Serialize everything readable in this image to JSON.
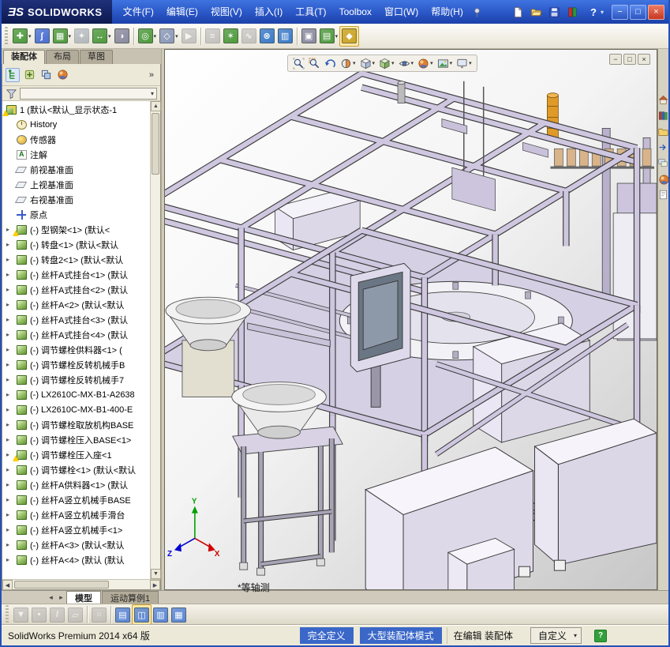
{
  "glyphs": {
    "dropdown": "▾"
  },
  "scrollbar": {
    "up": "▲",
    "down": "▼",
    "left": "◀",
    "right": "▶"
  },
  "colors": {
    "highlight_blue": "#3a67c8",
    "warning_yellow": "#ffcc00",
    "model_lavender": "#cfc7e0",
    "title_blue": "#2a56c6"
  },
  "titlebar": {
    "logo_prefix": "ƎS",
    "logo_name": "SOLIDWORKS",
    "menus": [
      "文件(F)",
      "编辑(E)",
      "视图(V)",
      "插入(I)",
      "工具(T)",
      "Toolbox",
      "窗口(W)",
      "帮助(H)"
    ],
    "quick_tools": [
      {
        "name": "new-document-icon",
        "icon": "new"
      },
      {
        "name": "open-document-icon",
        "icon": "open"
      },
      {
        "name": "save-document-icon",
        "icon": "save"
      },
      {
        "name": "options-icon",
        "icon": "options"
      }
    ],
    "help_label": "?",
    "controls": [
      {
        "name": "minimize-button",
        "glyph": "−"
      },
      {
        "name": "maximize-button",
        "glyph": "□"
      },
      {
        "name": "close-button",
        "glyph": "×"
      }
    ]
  },
  "main_toolbar": {
    "buttons": [
      {
        "name": "insert-components-button",
        "glyph": "✚",
        "color": "#4e9a3e",
        "dropdown": true
      },
      {
        "name": "mate-button",
        "glyph": "ʃ",
        "color": "#4a6fd4"
      },
      {
        "name": "linear-component-pattern-button",
        "glyph": "▦",
        "color": "#4e9a3e",
        "dropdown": true
      },
      {
        "name": "smart-fasteners-button",
        "glyph": "✦",
        "color": "#3a7ac8",
        "disabled": true
      },
      {
        "name": "move-component-button",
        "glyph": "↔",
        "color": "#4e9a3e",
        "dropdown": true
      },
      {
        "name": "show-hidden-components-button",
        "glyph": "◑",
        "color": "#8a8aa0"
      },
      {
        "sep": true
      },
      {
        "name": "assembly-features-button",
        "glyph": "◎",
        "color": "#4e9a3e",
        "dropdown": true
      },
      {
        "name": "reference-geometry-button",
        "glyph": "◇",
        "color": "#8a98b8",
        "dropdown": true
      },
      {
        "name": "new-motion-study-button",
        "glyph": "▶",
        "color": "#8a8aa0",
        "disabled": true
      },
      {
        "sep": true
      },
      {
        "name": "bill-of-materials-button",
        "glyph": "≡",
        "color": "#8a8aa0",
        "disabled": true
      },
      {
        "name": "exploded-view-button",
        "glyph": "✶",
        "color": "#4e9a3e"
      },
      {
        "name": "explode-line-sketch-button",
        "glyph": "∿",
        "color": "#8a8aa0",
        "disabled": true
      },
      {
        "name": "interference-detection-button",
        "glyph": "⊗",
        "color": "#3a7ac8"
      },
      {
        "name": "assembly-visualization-button",
        "glyph": "▥",
        "color": "#3a7ac8"
      },
      {
        "sep": true
      },
      {
        "name": "isolate-button",
        "glyph": "▣",
        "color": "#8a8aa0"
      },
      {
        "name": "large-assembly-mode-button",
        "glyph": "▤",
        "color": "#4e9a3e",
        "dropdown": true
      },
      {
        "name": "instant3d-button",
        "glyph": "◆",
        "color": "#caa428",
        "pressed": true
      }
    ]
  },
  "headsup": {
    "icons": [
      {
        "name": "zoom-to-fit-icon",
        "icon": "zoomfit"
      },
      {
        "name": "zoom-to-area-icon",
        "icon": "zoomarea"
      },
      {
        "name": "previous-view-icon",
        "icon": "prevview"
      },
      {
        "name": "section-view-icon",
        "icon": "section",
        "dropdown": true
      },
      {
        "name": "view-orientation-icon",
        "icon": "cube",
        "dropdown": true
      },
      {
        "name": "display-style-icon",
        "icon": "cube2",
        "dropdown": true
      },
      {
        "name": "hide-show-items-icon",
        "icon": "eye",
        "dropdown": true
      },
      {
        "name": "edit-appearance-icon",
        "icon": "ball",
        "dropdown": true
      },
      {
        "name": "apply-scene-icon",
        "icon": "scene",
        "dropdown": true
      },
      {
        "name": "view-settings-icon",
        "icon": "monitor",
        "dropdown": true
      }
    ],
    "child_controls": [
      {
        "name": "document-minimize-button",
        "glyph": "−"
      },
      {
        "name": "document-restore-button",
        "glyph": "□"
      },
      {
        "name": "document-close-button",
        "glyph": "×"
      }
    ]
  },
  "left_panel": {
    "tabs": [
      {
        "label": "装配体",
        "active": true
      },
      {
        "label": "布局",
        "active": false
      },
      {
        "label": "草图",
        "active": false
      }
    ],
    "manager_tabs": [
      {
        "name": "featuremanager-tab-icon",
        "icon": "fmtree",
        "selected": true
      },
      {
        "name": "propertymanager-tab-icon",
        "icon": "pmgr"
      },
      {
        "name": "configurationmanager-tab-icon",
        "icon": "cfgmgr"
      },
      {
        "name": "displaymanager-tab-icon",
        "icon": "ball"
      }
    ],
    "overflow_label": "»",
    "tree": [
      {
        "label": "1 (默认<默认_显示状态-1",
        "icon": "assembly",
        "warning": true,
        "expandable": false
      },
      {
        "label": "History",
        "icon": "history",
        "expandable": false
      },
      {
        "label": "传感器",
        "icon": "sensors",
        "expandable": false
      },
      {
        "label": "注解",
        "icon": "annotations",
        "expandable": false
      },
      {
        "label": "前视基准面",
        "icon": "plane",
        "expandable": false
      },
      {
        "label": "上视基准面",
        "icon": "plane",
        "expandable": false
      },
      {
        "label": "右视基准面",
        "icon": "plane",
        "expandable": false
      },
      {
        "label": "原点",
        "icon": "origin",
        "expandable": false
      },
      {
        "label": "(-) 型钢架<1> (默认<",
        "icon": "part",
        "warning": true,
        "expandable": true
      },
      {
        "label": "(-) 转盘<1> (默认<默认",
        "icon": "part",
        "expandable": true
      },
      {
        "label": "(-) 转盘2<1> (默认<默认",
        "icon": "part",
        "expandable": true
      },
      {
        "label": "(-) 丝杆A式挂台<1> (默认",
        "icon": "part",
        "expandable": true
      },
      {
        "label": "(-) 丝杆A式挂台<2> (默认",
        "icon": "part",
        "expandable": true
      },
      {
        "label": "(-) 丝杆A<2> (默认<默认",
        "icon": "part",
        "expandable": true
      },
      {
        "label": "(-) 丝杆A式挂台<3> (默认",
        "icon": "part",
        "expandable": true
      },
      {
        "label": "(-) 丝杆A式挂台<4> (默认",
        "icon": "part",
        "expandable": true
      },
      {
        "label": "(-) 调节螺栓供料器<1> (",
        "icon": "part",
        "expandable": true
      },
      {
        "label": "(-) 调节螺栓反转机械手B",
        "icon": "part",
        "expandable": true
      },
      {
        "label": "(-) 调节螺栓反转机械手7",
        "icon": "part",
        "expandable": true
      },
      {
        "label": "(-) LX2610C-MX-B1-A2638",
        "icon": "part",
        "expandable": true
      },
      {
        "label": "(-) LX2610C-MX-B1-400-E",
        "icon": "part",
        "expandable": true
      },
      {
        "label": "(-) 调节螺栓取放机构BASE",
        "icon": "part",
        "expandable": true
      },
      {
        "label": "(-) 调节螺栓压入BASE<1>",
        "icon": "part",
        "expandable": true
      },
      {
        "label": "(-) 调节螺栓压入座<1",
        "icon": "part",
        "warning": true,
        "expandable": true
      },
      {
        "label": "(-) 调节螺栓<1> (默认<默认",
        "icon": "part",
        "expandable": true
      },
      {
        "label": "(-) 丝杆A供料器<1> (默认",
        "icon": "part",
        "expandable": true
      },
      {
        "label": "(-) 丝杆A竖立机械手BASE",
        "icon": "part",
        "expandable": true
      },
      {
        "label": "(-) 丝杆A竖立机械手滑台",
        "icon": "part",
        "expandable": true
      },
      {
        "label": "(-) 丝杆A竖立机械手<1>",
        "icon": "part",
        "expandable": true
      },
      {
        "label": "(-) 丝杆A<3> (默认<默认",
        "icon": "part",
        "expandable": true
      },
      {
        "label": "(-) 丝杆A<4> (默认 (默认",
        "icon": "part",
        "expandable": true
      }
    ]
  },
  "task_pane": {
    "icons": [
      {
        "name": "solidworks-resources-icon",
        "icon": "home"
      },
      {
        "name": "design-library-icon",
        "icon": "library"
      },
      {
        "name": "file-explorer-icon",
        "icon": "folder"
      },
      {
        "name": "dock-expand-icon",
        "icon": "arrows"
      },
      {
        "name": "view-palette-icon",
        "icon": "palette"
      },
      {
        "name": "appearances-scenes-icon",
        "icon": "ball"
      },
      {
        "name": "custom-properties-icon",
        "icon": "page"
      }
    ]
  },
  "viewport": {
    "orientation_label": "*等轴测",
    "triad": {
      "x": "X",
      "y": "Y",
      "z": "Z"
    }
  },
  "bottom_tabs": {
    "nav": [
      {
        "name": "tab-scroll-left-button",
        "glyph": "◂"
      },
      {
        "name": "tab-scroll-right-button",
        "glyph": "▸"
      }
    ],
    "items": [
      {
        "label": "模型",
        "active": true
      },
      {
        "label": "运动算例1",
        "active": false
      }
    ]
  },
  "selection_toolbar": {
    "buttons": [
      {
        "name": "toggle-selection-filters-button",
        "glyph": "▼",
        "color": "#9a96a8",
        "disabled": true
      },
      {
        "name": "filter-vertices-button",
        "glyph": "•",
        "color": "#9a96a8",
        "disabled": true
      },
      {
        "name": "filter-edges-button",
        "glyph": "/",
        "color": "#9a96a8",
        "disabled": true
      },
      {
        "name": "filter-faces-button",
        "glyph": "▱",
        "color": "#9a96a8",
        "disabled": true
      },
      {
        "sep": true
      },
      {
        "name": "magnified-selection-button",
        "glyph": "○",
        "color": "#9a96a8",
        "disabled": true
      },
      {
        "sep": true
      },
      {
        "name": "large-assembly-toggle-button",
        "glyph": "▤",
        "color": "#5b87d6"
      },
      {
        "name": "lightweight-toggle-button",
        "glyph": "◫",
        "color": "#5b87d6",
        "pressed": true
      },
      {
        "name": "display-states-button",
        "glyph": "▥",
        "color": "#5b87d6"
      },
      {
        "name": "appearance-toggle-button",
        "glyph": "▦",
        "color": "#5b87d6"
      }
    ]
  },
  "status_bar": {
    "product": "SolidWorks Premium 2014 x64 版",
    "define_state": "完全定义",
    "mode": "大型装配体模式",
    "editing": "在编辑 装配体",
    "custom": "自定义",
    "help_glyph": "?"
  }
}
